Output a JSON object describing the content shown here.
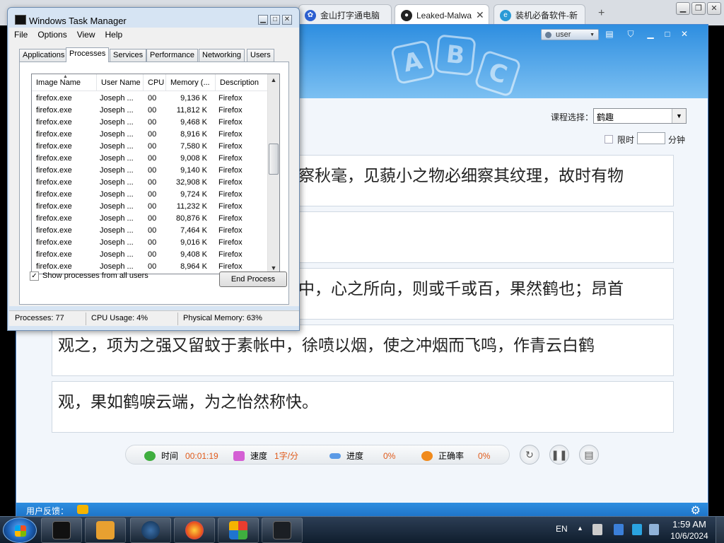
{
  "browser": {
    "tabs": [
      {
        "title": "金山打字通电脑",
        "icon": "paw-icon"
      },
      {
        "title": "Leaked-Malwa",
        "icon": "github-icon",
        "active": true
      },
      {
        "title": "装机必备软件-新",
        "icon": "e-icon"
      }
    ],
    "new_tab": "+"
  },
  "typing_app": {
    "header_letters": [
      "A",
      "B",
      "C"
    ],
    "user": "user",
    "course_label": "课程选择：",
    "course_value": "鹤趣",
    "limit_label": "限时",
    "limit_unit": "分钟",
    "text_lines": [
      "察秋毫，见藐小之物必细察其纹理，故时有物",
      "",
      "中，心之所向，则或千或百，果然鹤也；昂首",
      "观之，项为之强又留蚊于素帐中，徐喷以烟，使之冲烟而飞鸣，作青云白鹤",
      "观，果如鹤唳云端，为之怡然称快。"
    ],
    "stats": {
      "time_label": "时间",
      "time_value": "00:01:19",
      "speed_label": "速度",
      "speed_value": "1字/分",
      "progress_label": "进度",
      "progress_value": "0%",
      "accuracy_label": "正确率",
      "accuracy_value": "0%"
    },
    "footer_label": "用户反馈："
  },
  "task_manager": {
    "title": "Windows Task Manager",
    "menu": [
      "File",
      "Options",
      "View",
      "Help"
    ],
    "tabs": [
      "Applications",
      "Processes",
      "Services",
      "Performance",
      "Networking",
      "Users"
    ],
    "active_tab": "Processes",
    "columns": [
      "Image Name",
      "User Name",
      "CPU",
      "Memory (...",
      "Description"
    ],
    "rows": [
      [
        "firefox.exe",
        "Joseph ...",
        "00",
        "9,136 K",
        "Firefox"
      ],
      [
        "firefox.exe",
        "Joseph ...",
        "00",
        "11,812 K",
        "Firefox"
      ],
      [
        "firefox.exe",
        "Joseph ...",
        "00",
        "9,468 K",
        "Firefox"
      ],
      [
        "firefox.exe",
        "Joseph ...",
        "00",
        "8,916 K",
        "Firefox"
      ],
      [
        "firefox.exe",
        "Joseph ...",
        "00",
        "7,580 K",
        "Firefox"
      ],
      [
        "firefox.exe",
        "Joseph ...",
        "00",
        "9,008 K",
        "Firefox"
      ],
      [
        "firefox.exe",
        "Joseph ...",
        "00",
        "9,140 K",
        "Firefox"
      ],
      [
        "firefox.exe",
        "Joseph ...",
        "00",
        "32,908 K",
        "Firefox"
      ],
      [
        "firefox.exe",
        "Joseph ...",
        "00",
        "9,724 K",
        "Firefox"
      ],
      [
        "firefox.exe",
        "Joseph ...",
        "00",
        "11,232 K",
        "Firefox"
      ],
      [
        "firefox.exe",
        "Joseph ...",
        "00",
        "80,876 K",
        "Firefox"
      ],
      [
        "firefox.exe",
        "Joseph ...",
        "00",
        "7,464 K",
        "Firefox"
      ],
      [
        "firefox.exe",
        "Joseph ...",
        "00",
        "9,016 K",
        "Firefox"
      ],
      [
        "firefox.exe",
        "Joseph ...",
        "00",
        "9,408 K",
        "Firefox"
      ],
      [
        "firefox.exe",
        "Joseph ...",
        "00",
        "8,964 K",
        "Firefox"
      ]
    ],
    "show_all_label": "Show processes from all users",
    "show_all_checked": "✓",
    "end_process_label": "End Process",
    "status": {
      "processes": "Processes: 77",
      "cpu": "CPU Usage: 4%",
      "memory": "Physical Memory: 63%"
    }
  },
  "taskbar": {
    "language": "EN",
    "time": "1:59 AM",
    "date": "10/6/2024"
  }
}
